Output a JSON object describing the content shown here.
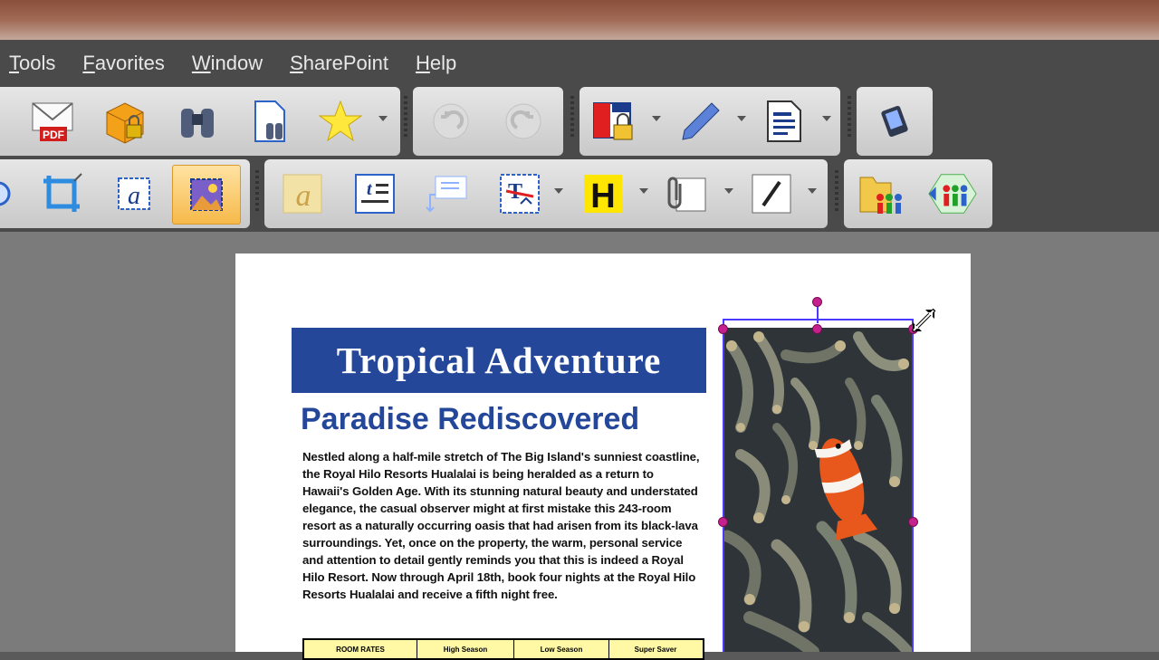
{
  "menu": {
    "items": [
      {
        "underline": "T",
        "rest": "ools"
      },
      {
        "underline": "F",
        "rest": "avorites"
      },
      {
        "underline": "W",
        "rest": "indow"
      },
      {
        "underline": "S",
        "rest": "harePoint"
      },
      {
        "underline": "H",
        "rest": "elp"
      }
    ]
  },
  "toolbar1": {
    "icons": [
      "email-pdf-icon",
      "secure-package-icon",
      "binoculars-icon",
      "document-search-icon",
      "star-icon",
      "undo-icon",
      "redo-icon",
      "security-lock-icon",
      "pencil-icon",
      "document-lines-icon",
      "device-icon"
    ],
    "pdf_badge": "PDF"
  },
  "toolbar2": {
    "icons": [
      "arrow-icon",
      "crop-icon",
      "text-field-icon",
      "image-select-icon",
      "signature-icon",
      "text-box-icon",
      "callout-icon",
      "text-edit-icon",
      "highlight-h-icon",
      "attachment-icon",
      "line-icon",
      "folder-users-icon",
      "users-share-icon"
    ],
    "highlight_letter": "H"
  },
  "document": {
    "banner_title": "Tropical Adventure",
    "subhead": "Paradise Rediscovered",
    "body": "Nestled along a half-mile stretch of The Big Island's sunniest coastline, the Royal Hilo Resorts Hualalai is being heralded as a return to Hawaii's Golden Age. With its stunning natural beauty and understated elegance, the casual observer might at first mistake this 243-room resort as a naturally occurring oasis that had arisen from its black-lava surroundings. Yet, once on the property, the warm, personal service and attention to detail gently reminds you that this is indeed a Royal Hilo Resort. Now through April 18th, book four nights at the Royal Hilo Resorts Hualalai and receive a fifth night free.",
    "table_headers": [
      "ROOM RATES",
      "High Season",
      "Low Season",
      "Super Saver"
    ]
  },
  "colors": {
    "banner": "#24479a",
    "subhead": "#24479a",
    "selection": "#4a3aff",
    "handle": "#c5208c"
  }
}
